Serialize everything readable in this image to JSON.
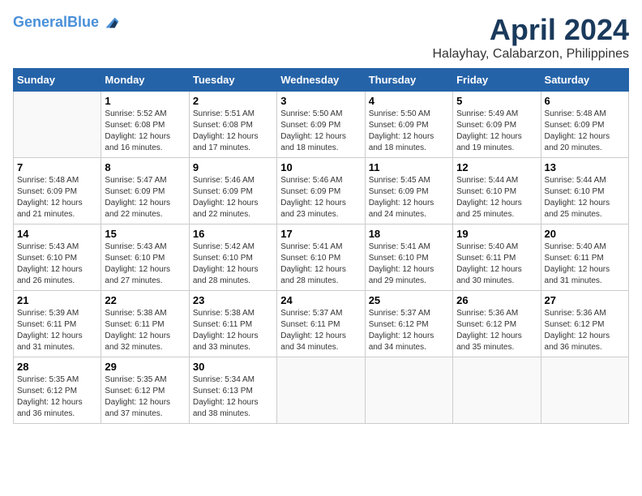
{
  "logo": {
    "line1": "General",
    "line2": "Blue"
  },
  "title": "April 2024",
  "subtitle": "Halayhay, Calabarzon, Philippines",
  "days_of_week": [
    "Sunday",
    "Monday",
    "Tuesday",
    "Wednesday",
    "Thursday",
    "Friday",
    "Saturday"
  ],
  "weeks": [
    [
      {
        "day": "",
        "sunrise": "",
        "sunset": "",
        "daylight": ""
      },
      {
        "day": "1",
        "sunrise": "Sunrise: 5:52 AM",
        "sunset": "Sunset: 6:08 PM",
        "daylight": "Daylight: 12 hours and 16 minutes."
      },
      {
        "day": "2",
        "sunrise": "Sunrise: 5:51 AM",
        "sunset": "Sunset: 6:08 PM",
        "daylight": "Daylight: 12 hours and 17 minutes."
      },
      {
        "day": "3",
        "sunrise": "Sunrise: 5:50 AM",
        "sunset": "Sunset: 6:09 PM",
        "daylight": "Daylight: 12 hours and 18 minutes."
      },
      {
        "day": "4",
        "sunrise": "Sunrise: 5:50 AM",
        "sunset": "Sunset: 6:09 PM",
        "daylight": "Daylight: 12 hours and 18 minutes."
      },
      {
        "day": "5",
        "sunrise": "Sunrise: 5:49 AM",
        "sunset": "Sunset: 6:09 PM",
        "daylight": "Daylight: 12 hours and 19 minutes."
      },
      {
        "day": "6",
        "sunrise": "Sunrise: 5:48 AM",
        "sunset": "Sunset: 6:09 PM",
        "daylight": "Daylight: 12 hours and 20 minutes."
      }
    ],
    [
      {
        "day": "7",
        "sunrise": "Sunrise: 5:48 AM",
        "sunset": "Sunset: 6:09 PM",
        "daylight": "Daylight: 12 hours and 21 minutes."
      },
      {
        "day": "8",
        "sunrise": "Sunrise: 5:47 AM",
        "sunset": "Sunset: 6:09 PM",
        "daylight": "Daylight: 12 hours and 22 minutes."
      },
      {
        "day": "9",
        "sunrise": "Sunrise: 5:46 AM",
        "sunset": "Sunset: 6:09 PM",
        "daylight": "Daylight: 12 hours and 22 minutes."
      },
      {
        "day": "10",
        "sunrise": "Sunrise: 5:46 AM",
        "sunset": "Sunset: 6:09 PM",
        "daylight": "Daylight: 12 hours and 23 minutes."
      },
      {
        "day": "11",
        "sunrise": "Sunrise: 5:45 AM",
        "sunset": "Sunset: 6:09 PM",
        "daylight": "Daylight: 12 hours and 24 minutes."
      },
      {
        "day": "12",
        "sunrise": "Sunrise: 5:44 AM",
        "sunset": "Sunset: 6:10 PM",
        "daylight": "Daylight: 12 hours and 25 minutes."
      },
      {
        "day": "13",
        "sunrise": "Sunrise: 5:44 AM",
        "sunset": "Sunset: 6:10 PM",
        "daylight": "Daylight: 12 hours and 25 minutes."
      }
    ],
    [
      {
        "day": "14",
        "sunrise": "Sunrise: 5:43 AM",
        "sunset": "Sunset: 6:10 PM",
        "daylight": "Daylight: 12 hours and 26 minutes."
      },
      {
        "day": "15",
        "sunrise": "Sunrise: 5:43 AM",
        "sunset": "Sunset: 6:10 PM",
        "daylight": "Daylight: 12 hours and 27 minutes."
      },
      {
        "day": "16",
        "sunrise": "Sunrise: 5:42 AM",
        "sunset": "Sunset: 6:10 PM",
        "daylight": "Daylight: 12 hours and 28 minutes."
      },
      {
        "day": "17",
        "sunrise": "Sunrise: 5:41 AM",
        "sunset": "Sunset: 6:10 PM",
        "daylight": "Daylight: 12 hours and 28 minutes."
      },
      {
        "day": "18",
        "sunrise": "Sunrise: 5:41 AM",
        "sunset": "Sunset: 6:10 PM",
        "daylight": "Daylight: 12 hours and 29 minutes."
      },
      {
        "day": "19",
        "sunrise": "Sunrise: 5:40 AM",
        "sunset": "Sunset: 6:11 PM",
        "daylight": "Daylight: 12 hours and 30 minutes."
      },
      {
        "day": "20",
        "sunrise": "Sunrise: 5:40 AM",
        "sunset": "Sunset: 6:11 PM",
        "daylight": "Daylight: 12 hours and 31 minutes."
      }
    ],
    [
      {
        "day": "21",
        "sunrise": "Sunrise: 5:39 AM",
        "sunset": "Sunset: 6:11 PM",
        "daylight": "Daylight: 12 hours and 31 minutes."
      },
      {
        "day": "22",
        "sunrise": "Sunrise: 5:38 AM",
        "sunset": "Sunset: 6:11 PM",
        "daylight": "Daylight: 12 hours and 32 minutes."
      },
      {
        "day": "23",
        "sunrise": "Sunrise: 5:38 AM",
        "sunset": "Sunset: 6:11 PM",
        "daylight": "Daylight: 12 hours and 33 minutes."
      },
      {
        "day": "24",
        "sunrise": "Sunrise: 5:37 AM",
        "sunset": "Sunset: 6:11 PM",
        "daylight": "Daylight: 12 hours and 34 minutes."
      },
      {
        "day": "25",
        "sunrise": "Sunrise: 5:37 AM",
        "sunset": "Sunset: 6:12 PM",
        "daylight": "Daylight: 12 hours and 34 minutes."
      },
      {
        "day": "26",
        "sunrise": "Sunrise: 5:36 AM",
        "sunset": "Sunset: 6:12 PM",
        "daylight": "Daylight: 12 hours and 35 minutes."
      },
      {
        "day": "27",
        "sunrise": "Sunrise: 5:36 AM",
        "sunset": "Sunset: 6:12 PM",
        "daylight": "Daylight: 12 hours and 36 minutes."
      }
    ],
    [
      {
        "day": "28",
        "sunrise": "Sunrise: 5:35 AM",
        "sunset": "Sunset: 6:12 PM",
        "daylight": "Daylight: 12 hours and 36 minutes."
      },
      {
        "day": "29",
        "sunrise": "Sunrise: 5:35 AM",
        "sunset": "Sunset: 6:12 PM",
        "daylight": "Daylight: 12 hours and 37 minutes."
      },
      {
        "day": "30",
        "sunrise": "Sunrise: 5:34 AM",
        "sunset": "Sunset: 6:13 PM",
        "daylight": "Daylight: 12 hours and 38 minutes."
      },
      {
        "day": "",
        "sunrise": "",
        "sunset": "",
        "daylight": ""
      },
      {
        "day": "",
        "sunrise": "",
        "sunset": "",
        "daylight": ""
      },
      {
        "day": "",
        "sunrise": "",
        "sunset": "",
        "daylight": ""
      },
      {
        "day": "",
        "sunrise": "",
        "sunset": "",
        "daylight": ""
      }
    ]
  ]
}
